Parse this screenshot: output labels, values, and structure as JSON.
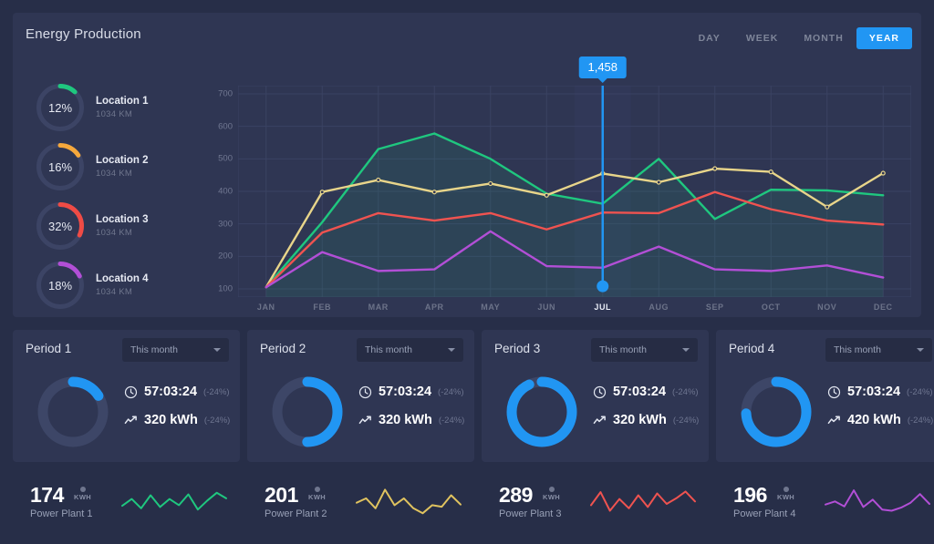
{
  "header": {
    "title": "Energy Production",
    "tabs": [
      {
        "label": "DAY",
        "active": false
      },
      {
        "label": "WEEK",
        "active": false
      },
      {
        "label": "MONTH",
        "active": false
      },
      {
        "label": "YEAR",
        "active": true
      }
    ],
    "accent_color": "#2196f3"
  },
  "locations": [
    {
      "name": "Location 1",
      "distance": "1034 KM",
      "percent": 12,
      "percent_label": "12%",
      "color": "#1fc77f"
    },
    {
      "name": "Location 2",
      "distance": "1034 KM",
      "percent": 16,
      "percent_label": "16%",
      "color": "#f5a83c"
    },
    {
      "name": "Location 3",
      "distance": "1034 KM",
      "percent": 32,
      "percent_label": "32%",
      "color": "#ef4b45"
    },
    {
      "name": "Location 4",
      "distance": "1034 KM",
      "percent": 18,
      "percent_label": "18%",
      "color": "#b24fd6"
    }
  ],
  "chart_data": {
    "type": "line",
    "title": "Energy Production",
    "xlabel": "",
    "ylabel": "",
    "ylim": [
      100,
      700
    ],
    "yticks": [
      700,
      600,
      500,
      400,
      300,
      200,
      100
    ],
    "grid": true,
    "legend_position": "left-donuts",
    "categories": [
      "JAN",
      "FEB",
      "MAR",
      "APR",
      "MAY",
      "JUN",
      "JUL",
      "AUG",
      "SEP",
      "OCT",
      "NOV",
      "DEC"
    ],
    "highlight_category": "JUL",
    "tooltip": {
      "value": "1,458",
      "category": "JUL",
      "marker_value": 108
    },
    "series": [
      {
        "name": "Location 1",
        "color": "#1fc77f",
        "values": [
          105,
          305,
          530,
          578,
          500,
          393,
          362,
          500,
          315,
          405,
          403,
          388
        ]
      },
      {
        "name": "Location 2",
        "color": "#e8d58a",
        "values": [
          105,
          398,
          435,
          398,
          424,
          388,
          455,
          428,
          470,
          460,
          352,
          456
        ]
      },
      {
        "name": "Location 3",
        "color": "#ef5350",
        "values": [
          105,
          273,
          333,
          310,
          333,
          283,
          335,
          333,
          398,
          345,
          310,
          298
        ]
      },
      {
        "name": "Location 4",
        "color": "#b24fd6",
        "values": [
          105,
          213,
          155,
          160,
          277,
          170,
          165,
          230,
          160,
          155,
          172,
          135
        ]
      }
    ]
  },
  "periods": [
    {
      "title": "Period 1",
      "range": "This month",
      "progress": 16,
      "time": "57:03:24",
      "time_delta": "(-24%)",
      "energy": "320 kWh",
      "energy_delta": "(-24%)"
    },
    {
      "title": "Period 2",
      "range": "This month",
      "progress": 50,
      "time": "57:03:24",
      "time_delta": "(-24%)",
      "energy": "320 kWh",
      "energy_delta": "(-24%)"
    },
    {
      "title": "Period 3",
      "range": "This month",
      "progress": 93,
      "time": "57:03:24",
      "time_delta": "(-24%)",
      "energy": "320 kWh",
      "energy_delta": "(-24%)"
    },
    {
      "title": "Period 4",
      "range": "This month",
      "progress": 74,
      "time": "57:03:24",
      "time_delta": "(-24%)",
      "energy": "420 kWh",
      "energy_delta": "(-24%)"
    }
  ],
  "plants": [
    {
      "value": "174",
      "unit": "KWH",
      "name": "Power Plant 1",
      "color": "#1fc77f",
      "spark": [
        38,
        60,
        30,
        72,
        34,
        60,
        40,
        75,
        26,
        55,
        80,
        62
      ]
    },
    {
      "value": "201",
      "unit": "KWH",
      "name": "Power Plant 2",
      "color": "#e0c35f",
      "spark": [
        48,
        62,
        30,
        90,
        40,
        62,
        30,
        14,
        40,
        35,
        72,
        42
      ]
    },
    {
      "value": "289",
      "unit": "KWH",
      "name": "Power Plant 3",
      "color": "#ef5350",
      "spark": [
        40,
        82,
        22,
        60,
        30,
        72,
        34,
        78,
        44,
        62,
        84,
        52
      ]
    },
    {
      "value": "196",
      "unit": "KWH",
      "name": "Power Plant 4",
      "color": "#b24fd6",
      "spark": [
        42,
        52,
        36,
        88,
        34,
        58,
        26,
        22,
        32,
        48,
        76,
        44
      ]
    }
  ]
}
